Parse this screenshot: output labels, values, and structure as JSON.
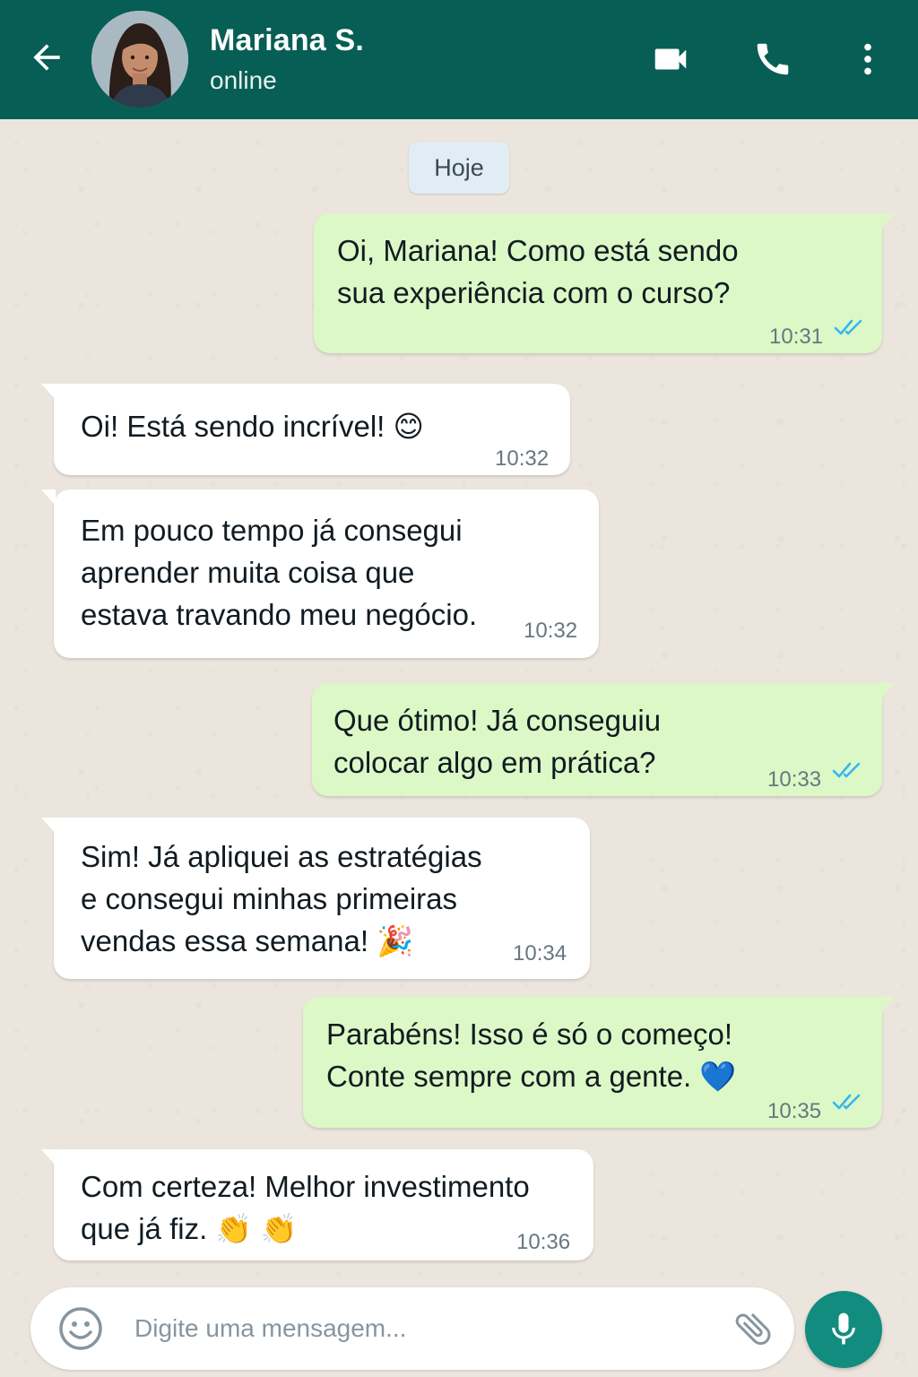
{
  "header": {
    "contact_name": "Mariana S.",
    "status": "online",
    "colors": {
      "bar": "#075e54",
      "text": "#ffffff"
    },
    "icons": [
      "back-arrow-icon",
      "video-call-icon",
      "phone-icon",
      "more-options-icon"
    ]
  },
  "chat": {
    "date_label": "Hoje",
    "messages": [
      {
        "direction": "outgoing",
        "text": "Oi, Mariana! Como está sendo\nsua experiência com o curso?",
        "time": "10:31",
        "status": "read"
      },
      {
        "direction": "incoming",
        "text": "Oi! Está sendo incrível! 😊",
        "time": "10:32"
      },
      {
        "direction": "incoming",
        "text": "Em pouco tempo já consegui\naprender muita coisa que\nestava travando meu negócio.",
        "time": "10:32"
      },
      {
        "direction": "outgoing",
        "text": "Que ótimo! Já conseguiu\ncolocar algo em prática?",
        "time": "10:33",
        "status": "read"
      },
      {
        "direction": "incoming",
        "text": "Sim! Já apliquei as estratégias\ne consegui minhas primeiras\nvendas essa semana! 🎉",
        "time": "10:34"
      },
      {
        "direction": "outgoing",
        "text": "Parabéns! Isso é só o começo!\nConte sempre com a gente. 💙",
        "time": "10:35",
        "status": "read"
      },
      {
        "direction": "incoming",
        "text": "Com certeza! Melhor investimento\nque já fiz. 👏 👏",
        "time": "10:36"
      }
    ],
    "colors": {
      "outgoing_bubble": "#dcf8c6",
      "incoming_bubble": "#ffffff",
      "read_ticks": "#34b7f1",
      "background": "#ece5dd"
    }
  },
  "composer": {
    "placeholder": "Digite uma mensagem...",
    "icons": [
      "emoji-icon",
      "attach-icon",
      "microphone-icon"
    ],
    "mic_color": "#128c7e"
  }
}
